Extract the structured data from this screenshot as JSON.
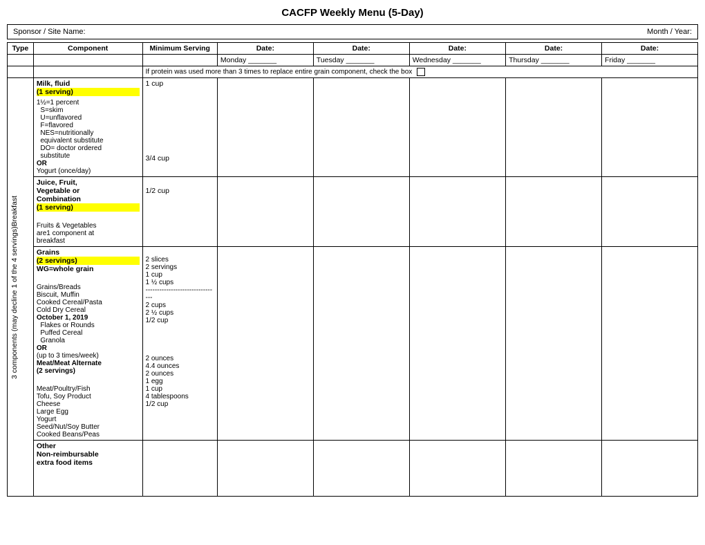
{
  "title": "CACFP Weekly Menu (5-Day)",
  "sponsor_label": "Sponsor / Site  Name:",
  "month_year_label": "Month / Year:",
  "columns": {
    "type": "Type",
    "component": "Component",
    "min_serving": "Minimum Serving",
    "date1": "Date:",
    "date2": "Date:",
    "date3": "Date:",
    "date4": "Date:",
    "date5": "Date:"
  },
  "day_labels": {
    "monday": "Monday  _______",
    "tuesday": "Tuesday  _______",
    "wednesday": "Wednesday  _______",
    "thursday": "Thursday  _______",
    "friday": "Friday  _______"
  },
  "protein_note": "If protein was used more than 3 times to replace entire grain component, check the box",
  "side_label": "3 components (may decline 1 of the 4 servings)Breakfast",
  "rows": [
    {
      "component_lines": [
        {
          "text": "Milk, fluid",
          "style": "bold"
        },
        {
          "text": "(1 serving)",
          "style": "highlight"
        }
      ],
      "component_extra": [
        "1½=1 percent",
        "  S=skim",
        "  U=unflavored",
        "  F=flavored",
        "  NES=nutritionally",
        "  equivalent substitute",
        "  DO= doctor ordered",
        "  substitute",
        "OR",
        "Yogurt (once/day)"
      ],
      "or_bold": true,
      "min_serving": "1 cup",
      "min_serving2": "3/4 cup"
    },
    {
      "component_lines": [
        {
          "text": "Juice, Fruit,",
          "style": "bold"
        },
        {
          "text": "Vegetable or",
          "style": "bold"
        },
        {
          "text": "Combination",
          "style": "bold"
        },
        {
          "text": "(1 serving)",
          "style": "highlight"
        }
      ],
      "component_extra": [
        "",
        "Fruits & Vegetables",
        "are1 component at",
        "breakfast"
      ],
      "min_serving": "1/2 cup"
    },
    {
      "component_lines": [
        {
          "text": "Grains",
          "style": "bold"
        },
        {
          "text": "(2 servings)",
          "style": "highlight"
        },
        {
          "text": "WG=whole grain",
          "style": "bold"
        }
      ],
      "component_extra": [
        "",
        "Grains/Breads",
        "Biscuit, Muffin",
        "Cooked Cereal/Pasta",
        "Cold Dry Cereal",
        "October 1, 2019",
        "  Flakes or Rounds",
        "  Puffed Cereal",
        "  Granola",
        "OR",
        "(up to 3 times/week)",
        "Meat/Meat Alternate",
        "(2 servings)"
      ],
      "min_servings_list": [
        "2 slices",
        "2 servings",
        "1 cup",
        "1 ½ cups",
        "--------------------------------",
        "2 cups",
        "2 ½ cups",
        "1/2 cup"
      ],
      "component_extra2": [
        "",
        "Meat/Poultry/Fish",
        "Tofu, Soy Product",
        "Cheese",
        "Large Egg",
        "Yogurt",
        "Seed/Nut/Soy Butter",
        "Cooked Beans/Peas"
      ],
      "min_servings_list2": [
        "2 ounces",
        "4.4 ounces",
        "2 ounces",
        "1 egg",
        "1 cup",
        "4 tablespoons",
        "1/2 cup"
      ]
    },
    {
      "component_lines": [
        {
          "text": "Other",
          "style": "bold"
        },
        {
          "text": "Non-reimbursable",
          "style": "bold"
        },
        {
          "text": "extra food items",
          "style": "bold"
        }
      ],
      "component_extra": [],
      "min_serving": ""
    }
  ]
}
